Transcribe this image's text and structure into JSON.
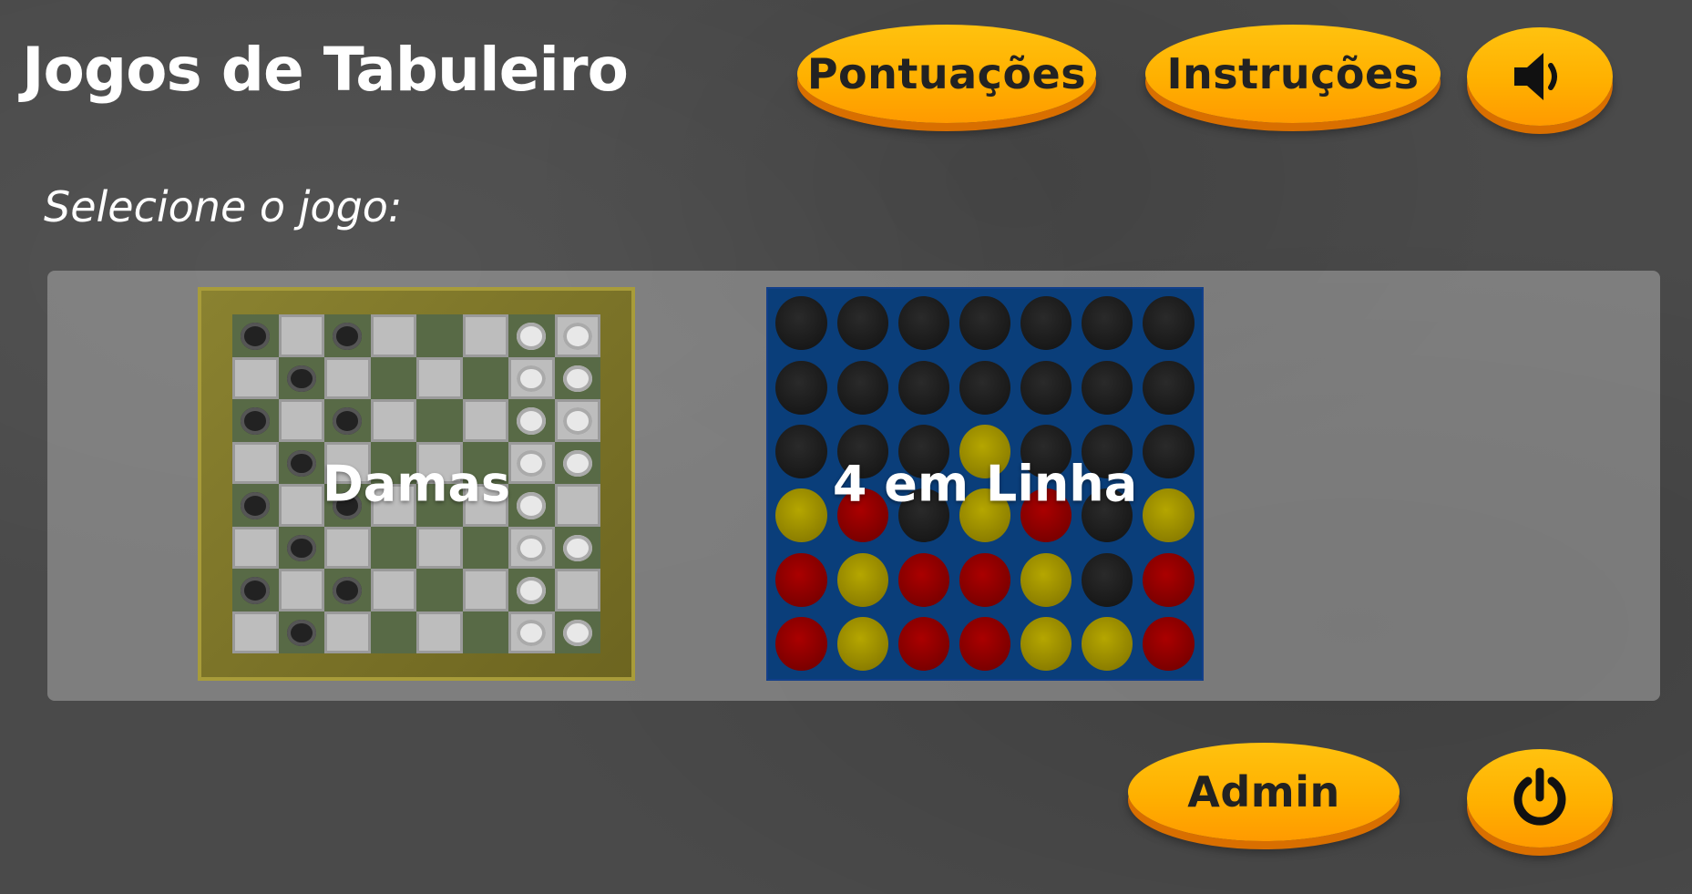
{
  "header": {
    "title": "Jogos de Tabuleiro",
    "scores_label": "Pontuações",
    "instructions_label": "Instruções",
    "sound_icon": "speaker-icon"
  },
  "main": {
    "subtitle": "Selecione o jogo:",
    "games": [
      {
        "label": "Damas",
        "board": "checkers"
      },
      {
        "label": "4 em Linha",
        "board": "connect-four"
      }
    ]
  },
  "footer": {
    "admin_label": "Admin",
    "power_icon": "power-icon"
  },
  "colors": {
    "accent": "#ffb000",
    "accent_shadow": "#d96f00",
    "connect_four_board": "#0a3e7a"
  },
  "checkers_board": [
    "b.b...ww",
    ".b....ww",
    "b.b...ww",
    ".b....ww",
    "b.b...w.",
    ".b....ww",
    "b.b...w.",
    ".b....ww"
  ],
  "connect_four_board": [
    "eeeeeee",
    "eeeeeee",
    "eeeyeee",
    "yreyrey",
    "ryrrye r",
    "ryrryyr"
  ]
}
